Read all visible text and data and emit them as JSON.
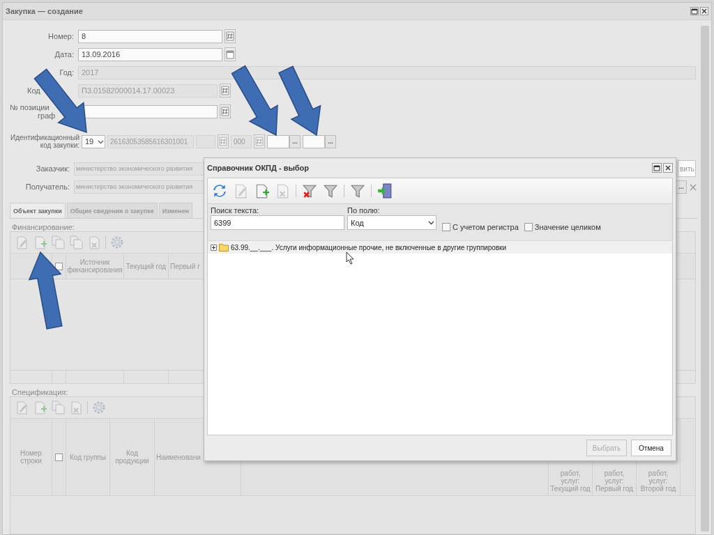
{
  "window": {
    "title": "Закупка — создание"
  },
  "fields": [
    {
      "kind": "number",
      "label": "Номер:",
      "value": "8",
      "disabled": false
    },
    {
      "kind": "date",
      "label": "Дата:",
      "value": "13.09.2016",
      "disabled": false
    },
    {
      "kind": "year",
      "label": "Год:",
      "value": "2017",
      "disabled": true
    },
    {
      "kind": "code",
      "label": "Код",
      "value": "П3.01582000014.17.00023",
      "disabled": true
    },
    {
      "kind": "position",
      "label": "№ позиции",
      "label_2": "граф",
      "disabled": false
    }
  ],
  "ident": {
    "label": "Идентификационный код закупки:",
    "year": "19",
    "parts": [
      {
        "kind": "text",
        "value": "26163053585616301001"
      },
      {
        "kind": "blank"
      },
      {
        "kind": "icon"
      },
      {
        "kind": "text",
        "value": "000"
      },
      {
        "kind": "icon"
      },
      {
        "kind": "picker",
        "button": "..."
      },
      {
        "kind": "picker",
        "button": "..."
      }
    ]
  },
  "parties": [
    {
      "kind": "customer",
      "label": "Заказчик:",
      "value": "министерство экономического развития",
      "action": "вить"
    },
    {
      "kind": "recipient",
      "label": "Получатель:",
      "value": "министерство экономического развития",
      "action": "..."
    }
  ],
  "tabs": [
    {
      "label": "Объект закупки",
      "selected": true
    },
    {
      "label": "Общие сведения о закупке",
      "selected": false
    },
    {
      "label": "Изменен",
      "selected": false
    }
  ],
  "financing": {
    "title": "Финансирование:",
    "checked": false,
    "columns": [
      "Источник финансирования",
      "Текущий год",
      "Первый г"
    ]
  },
  "spec": {
    "title": "Спецификация:",
    "checked": false,
    "columns": [
      "Номер строки",
      "Код группы",
      "Код продукции",
      "Наименовани"
    ],
    "right_columns": [
      "работ, услуг: Текущий год",
      "работ, услуг: Первый год",
      "работ, услуг: Второй год"
    ]
  },
  "dialog": {
    "title": "Справочник ОКПД - выбор",
    "toolbar": [
      {
        "kind": "refresh",
        "disabled": false
      },
      {
        "kind": "edit",
        "disabled": true
      },
      {
        "kind": "add",
        "disabled": false
      },
      {
        "kind": "delete",
        "disabled": true
      },
      {
        "kind": "filter-clear",
        "disabled": false
      },
      {
        "kind": "filter",
        "disabled": false
      },
      {
        "kind": "filter",
        "disabled": false
      },
      {
        "kind": "exit",
        "disabled": false
      }
    ],
    "search": {
      "label": "Поиск текста:",
      "value": "6399"
    },
    "field": {
      "label": "По полю:",
      "value": "Код"
    },
    "options": [
      {
        "label": "С учетом регистра",
        "checked": false
      },
      {
        "label": "Значение целиком",
        "checked": false
      }
    ],
    "tree": [
      {
        "label": "63.99.__.___. Услуги информационные прочие, не включенные в другие группировки",
        "expanded": false,
        "selected": true
      }
    ],
    "buttons": [
      {
        "label": "Выбрать",
        "disabled": true
      },
      {
        "label": "Отмена",
        "disabled": false
      }
    ]
  }
}
